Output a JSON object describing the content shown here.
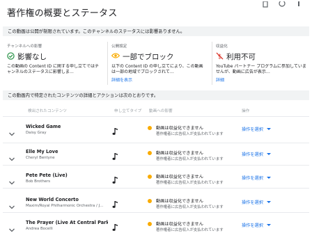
{
  "page": {
    "title": "著作権の概要とステータス"
  },
  "notice_restricted": "この動画は公開が制限されています。このチャンネルのステータスには影響ありません。",
  "summary": [
    {
      "heading": "チャンネルへの影響",
      "status": "影響なし",
      "icon": "check-circle-icon",
      "color": "#1e8e3e",
      "desc": "この動画の Content ID に関する申し立てではチャンネルのステータスに影響しま…",
      "link": ""
    },
    {
      "heading": "公開設定",
      "status": "一部でブロック",
      "icon": "eye-icon",
      "color": "#f9ab00",
      "desc": "以下の Content ID の申し立てにより、この動画は一部の地域でブロックされて…",
      "link": "詳細を表示"
    },
    {
      "heading": "収益化",
      "status": "利用不可",
      "icon": "no-money-icon",
      "color": "#d93025",
      "desc": "YouTube パートナー プログラムに参加していませんが、動画に広告が表示…",
      "link": "詳細"
    }
  ],
  "notice_details": "この動画内で特定されたコンテンツの詳細とアクションは次のとおりです。",
  "table": {
    "headers": [
      "検出されたコンテンツ",
      "申し立てタイプ",
      "動画への影響",
      "操作"
    ],
    "rows": [
      {
        "title": "Wicked Game",
        "artist": "Daisy Gray",
        "impact": "動画は収益化できません",
        "impact_sub": "著作権者に広告収入が支払われています",
        "action": "操作を選択"
      },
      {
        "title": "Elle My Love",
        "artist": "Cheryl Bentyne",
        "impact": "動画は収益化できません",
        "impact_sub": "著作権者に広告収入が支払われています",
        "action": "操作を選択"
      },
      {
        "title": "Pete Pete (Live)",
        "artist": "Bob Brothers",
        "impact": "動画は収益化できません",
        "impact_sub": "著作権者に広告収入が支払われています",
        "action": "操作を選択"
      },
      {
        "title": "New World Concerto",
        "artist": "Maxim/Royal Philharmonic Orchestra / J…",
        "impact": "動画は収益化できません",
        "impact_sub": "著作権者に広告収入が支払われています",
        "action": "操作を選択"
      },
      {
        "title": "The Prayer (Live At Central Park, New…",
        "artist": "Andrea Bocelli",
        "impact": "動画は収益化できません",
        "impact_sub": "著作権者に広告収入が支払われています",
        "action": "操作を選択"
      }
    ]
  },
  "colors": {
    "accent": "#1a73e8",
    "warning": "#f9ab00",
    "ok": "#1e8e3e",
    "error": "#d93025",
    "strip": "#f1f3f4"
  }
}
